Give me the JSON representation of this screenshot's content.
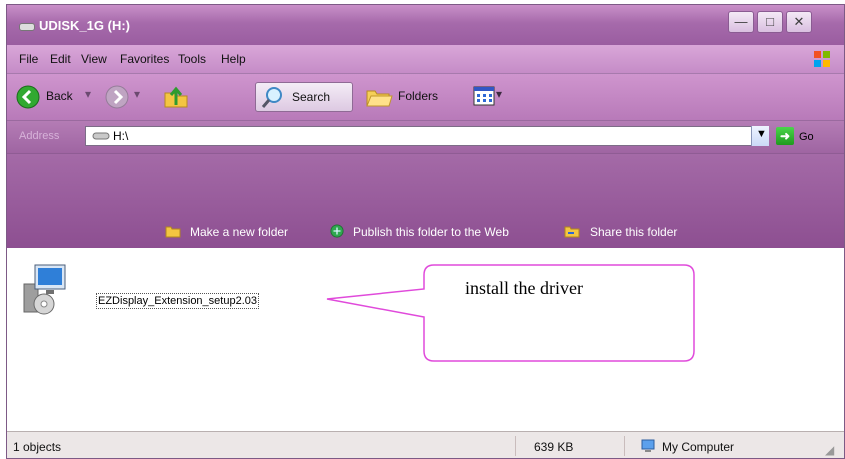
{
  "window": {
    "title": "UDISK_1G (H:)",
    "controls": [
      "minimize",
      "maximize",
      "close"
    ]
  },
  "menu": {
    "items": [
      "File",
      "Edit",
      "View",
      "Favorites",
      "Tools",
      "Help"
    ]
  },
  "toolbar": {
    "back_label": "Back",
    "search_label": "Search",
    "folders_label": "Folders"
  },
  "address": {
    "label": "Address",
    "value": "H:\\",
    "go_label": "Go"
  },
  "tasks": {
    "new_folder": "Make a new folder",
    "publish": "Publish this folder to the Web",
    "share": "Share this folder"
  },
  "files": [
    {
      "name": "EZDisplay_Extension_setup2.03",
      "icon": "installer-icon"
    }
  ],
  "callout": {
    "text": "install the driver"
  },
  "status": {
    "objects": "1 objects",
    "size": "639 KB",
    "zone": "My Computer"
  },
  "colors": {
    "title_gradient_top": "#c98fc8",
    "task_bg": "#9b5ea0",
    "callout_border": "#e04adb"
  }
}
